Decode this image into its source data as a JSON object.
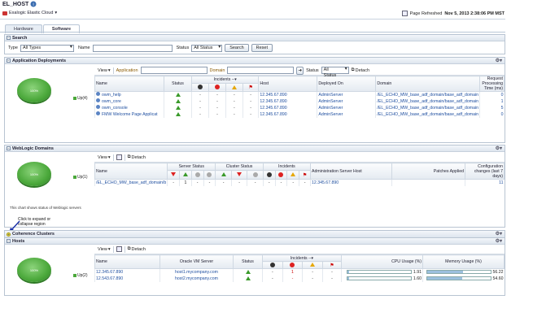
{
  "header": {
    "title": "EL_HOST",
    "target_menu": "Exalogic Elastic Cloud",
    "refresh_label": "Page Refreshed",
    "refresh_time": "Nov 5, 2013 2:38:06 PM MST"
  },
  "tabs": [
    {
      "label": "Hardware",
      "active": false
    },
    {
      "label": "Software",
      "active": true
    }
  ],
  "search": {
    "title": "Search",
    "type_label": "Type",
    "type_value": "All Types",
    "name_label": "Name",
    "name_value": "",
    "status_label": "Status",
    "status_value": "All Status",
    "search_button": "Search",
    "reset_button": "Reset"
  },
  "app_deployments": {
    "title": "Application Deployments",
    "legend": "Up(4)",
    "pie_label": "100%",
    "toolbar": {
      "view": "View",
      "application_label": "Application",
      "domain_label": "Domain",
      "status_label": "Status",
      "status_value": "All Status",
      "detach": "Detach"
    },
    "columns": {
      "name": "Name",
      "status": "Status",
      "incidents": "Incidents",
      "host": "Host",
      "deployed_on": "Deployed On",
      "domain": "Domain",
      "processing": "Request Processing Time (ms)"
    },
    "rows": [
      {
        "name": "owm_help",
        "host": "12.345.67.890",
        "deployed": "AdminServer",
        "domain": "/EL_ECHO_MW_base_adf_domain/base_adf_domain",
        "time": "0"
      },
      {
        "name": "owm_core",
        "host": "12.345.67.890",
        "deployed": "AdminServer",
        "domain": "/EL_ECHO_MW_base_adf_domain/base_adf_domain",
        "time": "1"
      },
      {
        "name": "owm_console",
        "host": "12.345.67.890",
        "deployed": "AdminServer",
        "domain": "/EL_ECHO_MW_base_adf_domain/base_adf_domain",
        "time": "5"
      },
      {
        "name": "FMW Welcome Page Applicat",
        "host": "12.345.67.890",
        "deployed": "AdminServer",
        "domain": "/EL_ECHO_MW_base_adf_domain/base_adf_domain",
        "time": "0"
      }
    ],
    "dash": "-"
  },
  "weblogic": {
    "title": "WebLogic Domains",
    "legend": "Up(1)",
    "pie_label": "100%",
    "note": "This chart shows status of Weblogic servers",
    "toolbar": {
      "view": "View",
      "detach": "Detach"
    },
    "columns": {
      "name": "Name",
      "server_status": "Server Status",
      "cluster_status": "Cluster Status",
      "incidents": "Incidents",
      "admin_host": "Administration Server Host",
      "patches": "Patches Applied",
      "config": "Configuration changes (last 7 days)"
    },
    "row": {
      "name": "/EL_ECHO_MW_base_adf_domain/b",
      "down": "-",
      "up": "1",
      "host": "12.345.67.890",
      "config": "11"
    }
  },
  "callout": {
    "line1": "Click to expand or",
    "line2": "collapse region"
  },
  "coherence": {
    "title": "Coherence Clusters"
  },
  "hosts": {
    "title": "Hosts",
    "legend": "Up(2)",
    "pie_label": "100%",
    "toolbar": {
      "view": "View",
      "detach": "Detach"
    },
    "columns": {
      "name": "Name",
      "vm_server": "Oracle VM Server",
      "status": "Status",
      "incidents": "Incidents",
      "cpu": "CPU Usage (%)",
      "memory": "Memory Usage (%)"
    },
    "rows": [
      {
        "name": "12.345.67.890",
        "vm": "host1.mycompany.com",
        "inc_red": "1",
        "cpu": "1.91",
        "cpu_pct": 1.91,
        "mem": "56.22",
        "mem_pct": 56.22
      },
      {
        "name": "12.543.67.890",
        "vm": "host2.mycompany.com",
        "inc_red": "-",
        "cpu": "1.60",
        "cpu_pct": 1.6,
        "mem": "54.60",
        "mem_pct": 54.6
      }
    ]
  }
}
